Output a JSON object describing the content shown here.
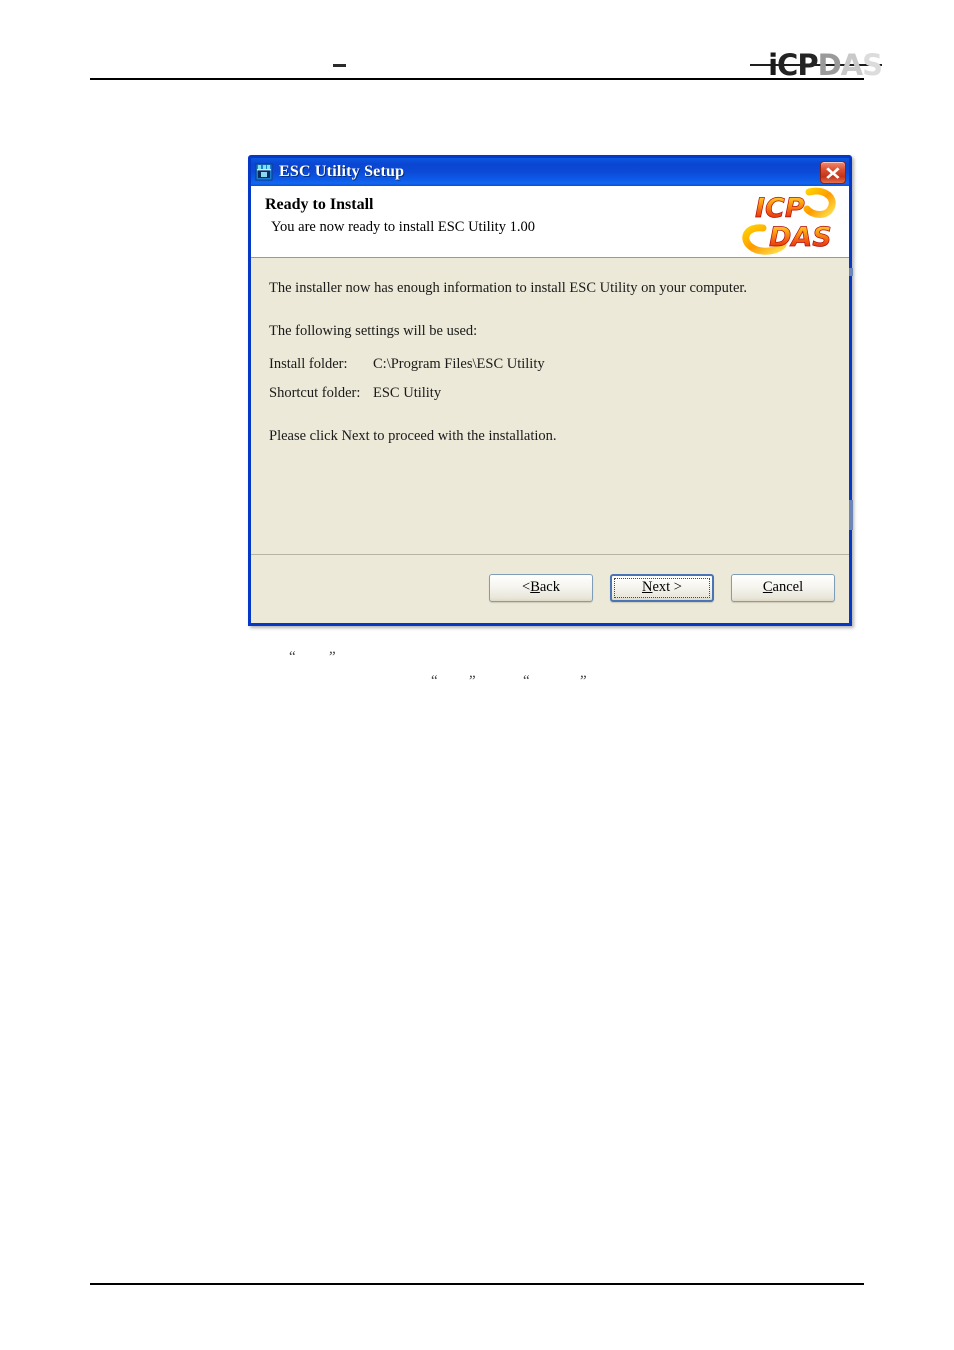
{
  "document": {
    "header_logo": {
      "parts": [
        {
          "text": "i",
          "tone": "dark"
        },
        {
          "text": "CP",
          "tone": "dark"
        },
        {
          "text": "D",
          "tone": "mid"
        },
        {
          "text": "A",
          "tone": "light"
        },
        {
          "text": "S",
          "tone": "lighter"
        }
      ],
      "alt": "icpdas-logo"
    },
    "header_dash": "—",
    "caption_quotes": [
      {
        "open": "“",
        "close": "”"
      },
      {
        "open": "“",
        "close": "”"
      },
      {
        "open": "“",
        "close": "”"
      }
    ]
  },
  "dialog": {
    "titlebar": {
      "icon": "setup-installer-icon",
      "title": "ESC Utility Setup",
      "close_label": "close-icon"
    },
    "header": {
      "title": "Ready to Install",
      "subtitle": "You are now ready to install ESC Utility 1.00",
      "logo_line1": "ICP",
      "logo_line2": "DAS",
      "logo_alt": "icpdas-flame-logo"
    },
    "body": {
      "intro": "The installer now has enough information to install ESC Utility on your computer.",
      "settings_heading": "The following settings will be used:",
      "settings": [
        {
          "key": "Install folder:",
          "value": "C:\\Program Files\\ESC Utility"
        },
        {
          "key": "Shortcut folder:",
          "value": "ESC Utility"
        }
      ],
      "outro": "Please click Next to proceed with the installation."
    },
    "buttons": {
      "back": {
        "pre": "< ",
        "accel": "B",
        "post": "ack"
      },
      "next": {
        "pre": "",
        "accel": "N",
        "post": "ext >"
      },
      "cancel": {
        "pre": "",
        "accel": "C",
        "post": "ancel"
      }
    }
  },
  "colors": {
    "titlebar_blue": "#0a4cd8",
    "dialog_border": "#0538c4",
    "body_beige": "#ece9d8",
    "close_red": "#c33317",
    "button_border": "#7f9db9",
    "default_button_border": "#4a74b4",
    "logo_red": "#e02020",
    "logo_orange": "#f08a12",
    "logo_yellow": "#ffd400"
  }
}
